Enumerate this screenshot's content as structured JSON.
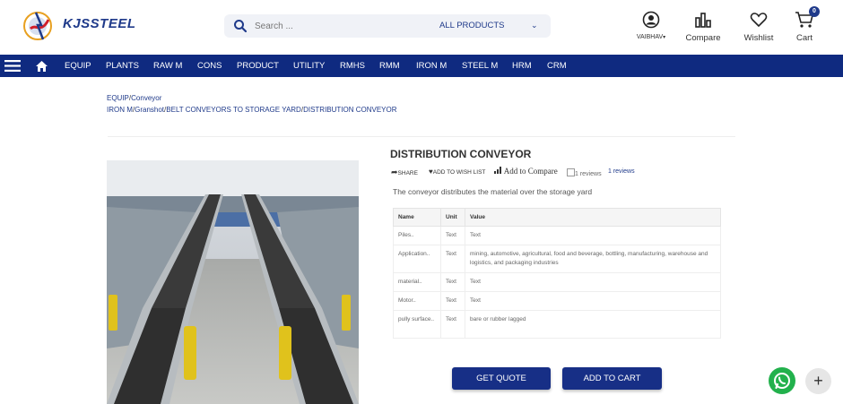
{
  "header": {
    "brand": "KJSSTEEL",
    "search": {
      "placeholder": "Search ...",
      "category": "ALL PRODUCTS"
    },
    "account_label": "VAIBHAV",
    "compare_label": "Compare",
    "wishlist_label": "Wishlist",
    "cart_label": "Cart",
    "cart_count": "0"
  },
  "nav": {
    "items": [
      "EQUIP",
      "PLANTS",
      "RAW M",
      "CONS",
      "PRODUCT",
      "UTILITY",
      "RMHS",
      "RMM",
      "IRON M",
      "STEEL M",
      "HRM",
      "CRM"
    ]
  },
  "breadcrumbs": {
    "line1": [
      "EQUIP",
      "Conveyor"
    ],
    "line2": [
      "IRON M",
      "Granshot",
      "BELT CONVEYORS TO STORAGE YARD",
      "DISTRIBUTION CONVEYOR"
    ]
  },
  "product": {
    "title": "DISTRIBUTION CONVEYOR",
    "share_label": "SHARE",
    "wishlist_label": "ADD TO WISH LIST",
    "compare_label": "Add to Compare",
    "reviews_img_alt": "1 reviews",
    "reviews_link": "1 reviews",
    "description": "The conveyor distributes the material over the storage yard",
    "table": {
      "headers": [
        "Name",
        "Unit",
        "Value"
      ],
      "rows": [
        [
          "Piles..",
          "Text",
          "Text"
        ],
        [
          "Application..",
          "Text",
          "mining, automotive, agricultural, food and beverage, bottling, manufacturing, warehouse and logistics, and packaging industries"
        ],
        [
          "material..",
          "Text",
          "Text"
        ],
        [
          "Motor..",
          "Text",
          "Text"
        ],
        [
          "pully surface..",
          "Text",
          "bare or rubber lagged"
        ]
      ]
    },
    "get_quote_label": "GET QUOTE",
    "add_to_cart_label": "ADD TO CART"
  },
  "colors": {
    "brand_blue": "#0f2a80",
    "button_blue": "#172f86",
    "whatsapp_green": "#22b14c"
  }
}
